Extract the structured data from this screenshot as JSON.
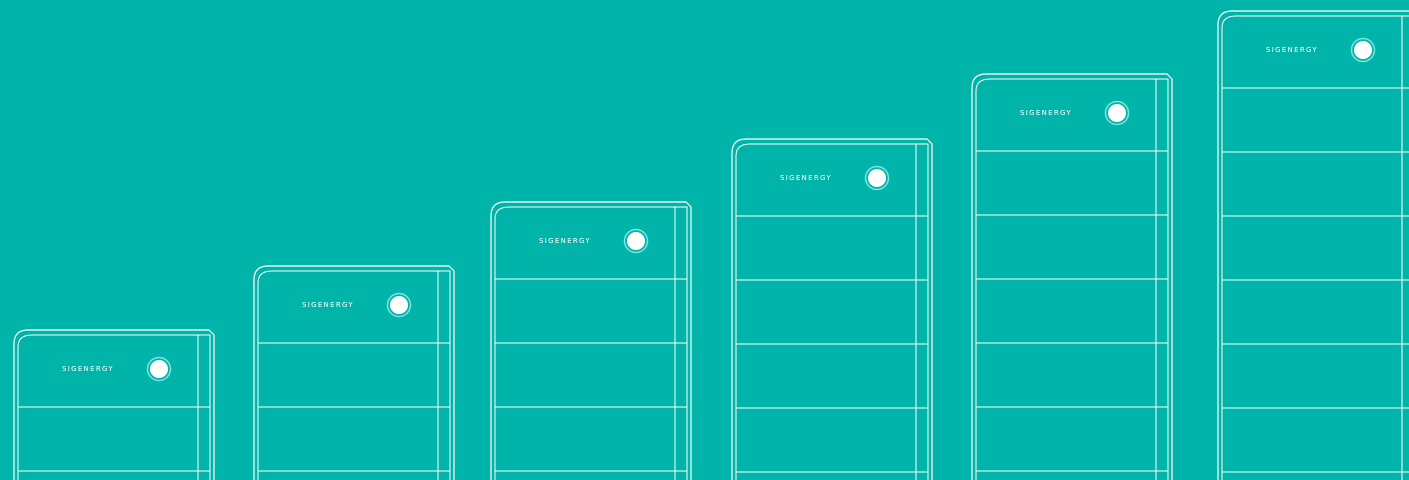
{
  "scene": {
    "background_color": "#01b4aa",
    "line_color": "#ffffff",
    "description_free": true
  },
  "brand_label": "SIGENERGY",
  "battery_stacks": [
    {
      "modules": 1,
      "brand": "SIGENERGY"
    },
    {
      "modules": 2,
      "brand": "SIGENERGY"
    },
    {
      "modules": 3,
      "brand": "SIGENERGY"
    },
    {
      "modules": 4,
      "brand": "SIGENERGY"
    },
    {
      "modules": 5,
      "brand": "SIGENERGY"
    },
    {
      "modules": 6,
      "brand": "SIGENERGY"
    }
  ]
}
